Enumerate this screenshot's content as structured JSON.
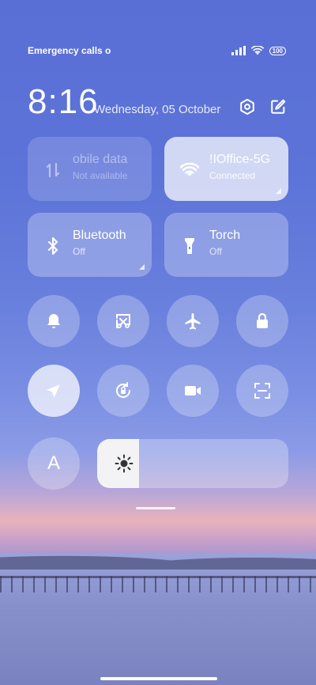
{
  "status_bar": {
    "carrier_text": "Emergency calls o",
    "battery": "100"
  },
  "header": {
    "time": "8:16",
    "date": "Wednesday, 05 October"
  },
  "tiles": {
    "mobile_data": {
      "title": "obile data",
      "subtitle": "Not available",
      "state": "disabled"
    },
    "wifi": {
      "title": "!IOffice-5G",
      "subtitle": "Connected",
      "state": "on"
    },
    "bluetooth": {
      "title": "Bluetooth",
      "subtitle": "Off",
      "state": "off"
    },
    "torch": {
      "title": "Torch",
      "subtitle": "Off",
      "state": "off"
    }
  },
  "toggles_row1": [
    "bell-icon",
    "screenshot-icon",
    "airplane-icon",
    "lock-icon"
  ],
  "toggles_row2": [
    "location-icon",
    "rotation-lock-icon",
    "video-icon",
    "scan-icon"
  ],
  "font_button": {
    "label": "A"
  },
  "brightness": {
    "level": 0.22
  },
  "colors": {
    "accent_active": "#ffffff",
    "tile_bg": "rgba(255,255,255,0.28)"
  }
}
